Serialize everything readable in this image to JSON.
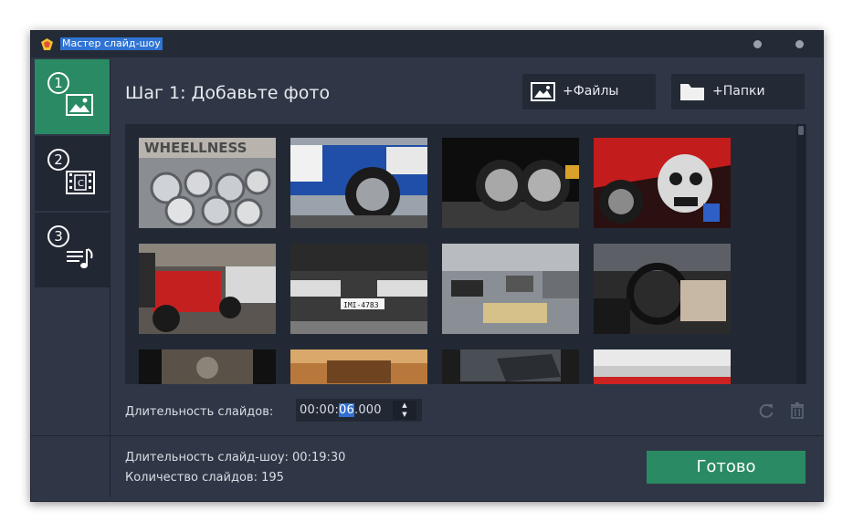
{
  "window": {
    "title": "Мастер слайд-шоу"
  },
  "sidebar": {
    "steps": [
      {
        "number": "1",
        "icon": "image-icon",
        "active": true
      },
      {
        "number": "2",
        "icon": "film-clip-icon",
        "active": false
      },
      {
        "number": "3",
        "icon": "music-list-icon",
        "active": false
      }
    ]
  },
  "header": {
    "step_title": "Шаг 1: Добавьте фото",
    "add_files_label": "+Файлы",
    "add_folders_label": "+Папки"
  },
  "gallery": {
    "thumbnails": [
      {
        "subject": "stacked alloy wheels with WHEELLNESS sign",
        "caption": "WHEELLNESS"
      },
      {
        "subject": "blue drift car front wheel"
      },
      {
        "subject": "pair of rear wheels"
      },
      {
        "subject": "skull graphic on car"
      },
      {
        "subject": "red cars in garage"
      },
      {
        "subject": "black Mitsubishi front",
        "caption": "IMI-4783"
      },
      {
        "subject": "garage workshop with cars"
      },
      {
        "subject": "car interior steering wheel"
      },
      {
        "subject": "car engine bay"
      },
      {
        "subject": "wooden interior close-up"
      },
      {
        "subject": "car fender close-up"
      },
      {
        "subject": "white car exterior"
      }
    ]
  },
  "duration": {
    "label": "Длительность слайдов:",
    "value_prefix": "00:00:",
    "value_selected": "06",
    "value_suffix": ".000",
    "spin_up": "▲",
    "spin_down": "▼"
  },
  "footer": {
    "show_duration": "Длительность слайд-шоу: 00:19:30",
    "slide_count": "Количество слайдов: 195",
    "done_label": "Готово"
  },
  "colors": {
    "accent_green": "#2a8a63",
    "selection_blue": "#3070d3",
    "window_bg": "#2f3746"
  }
}
